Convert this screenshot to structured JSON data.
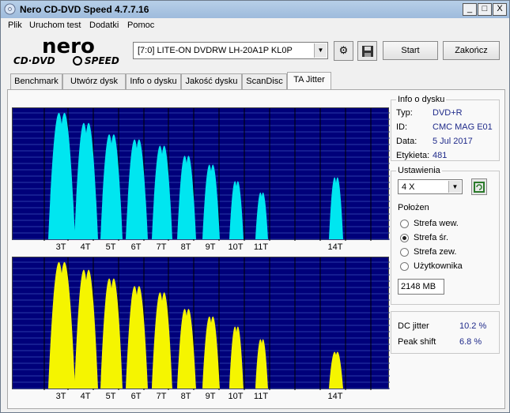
{
  "window": {
    "title": "Nero CD-DVD Speed 4.7.7.16",
    "min": "_",
    "max": "□",
    "close": "X"
  },
  "menu": [
    "Plik",
    "Uruchom test",
    "Dodatki",
    "Pomoc"
  ],
  "logo": {
    "line1": "nero",
    "line2": "CD·DVD",
    "line3": "SPEED"
  },
  "drive": {
    "selected": "[7:0]   LITE-ON DVDRW LH-20A1P KL0P"
  },
  "buttons": {
    "start": "Start",
    "exit": "Zakończ"
  },
  "tabs": [
    "Benchmark",
    "Utwórz dysk",
    "Info o dysku",
    "Jakość dysku",
    "ScanDisc",
    "TA Jitter"
  ],
  "active_tab": "TA Jitter",
  "disc_info": {
    "title": "Info o dysku",
    "rows": [
      {
        "label": "Typ:",
        "value": "DVD+R"
      },
      {
        "label": "ID:",
        "value": "CMC MAG E01"
      },
      {
        "label": "Data:",
        "value": "5 Jul 2017"
      },
      {
        "label": "Etykieta:",
        "value": "481"
      }
    ]
  },
  "settings": {
    "title": "Ustawienia",
    "speed": "4 X",
    "position_title": "Położen",
    "positions": [
      {
        "label": "Strefa wew.",
        "selected": false
      },
      {
        "label": "Strefa śr.",
        "selected": true
      },
      {
        "label": "Strefa zew.",
        "selected": false
      },
      {
        "label": "Użytkownika",
        "selected": false
      }
    ],
    "size": "2148 MB"
  },
  "results": {
    "dc_jitter_label": "DC jitter",
    "dc_jitter_value": "10.2 %",
    "peak_shift_label": "Peak shift",
    "peak_shift_value": "6.8 %"
  },
  "colors": {
    "chart_bg": "#00007a",
    "grid": "#2a3aa8",
    "top_series": "#00e6f0",
    "bottom_series": "#f5f500"
  },
  "chart_data": [
    {
      "type": "area",
      "name": "Land",
      "categories": [
        "3T",
        "4T",
        "5T",
        "6T",
        "7T",
        "8T",
        "9T",
        "10T",
        "11T",
        "14T"
      ],
      "peaks": [
        1.0,
        0.92,
        0.83,
        0.79,
        0.74,
        0.66,
        0.59,
        0.46,
        0.37,
        0.49
      ]
    },
    {
      "type": "area",
      "name": "Pit",
      "categories": [
        "3T",
        "4T",
        "5T",
        "6T",
        "7T",
        "8T",
        "9T",
        "10T",
        "11T",
        "14T"
      ],
      "peaks": [
        1.0,
        0.94,
        0.87,
        0.81,
        0.76,
        0.63,
        0.57,
        0.49,
        0.39,
        0.29
      ]
    }
  ]
}
